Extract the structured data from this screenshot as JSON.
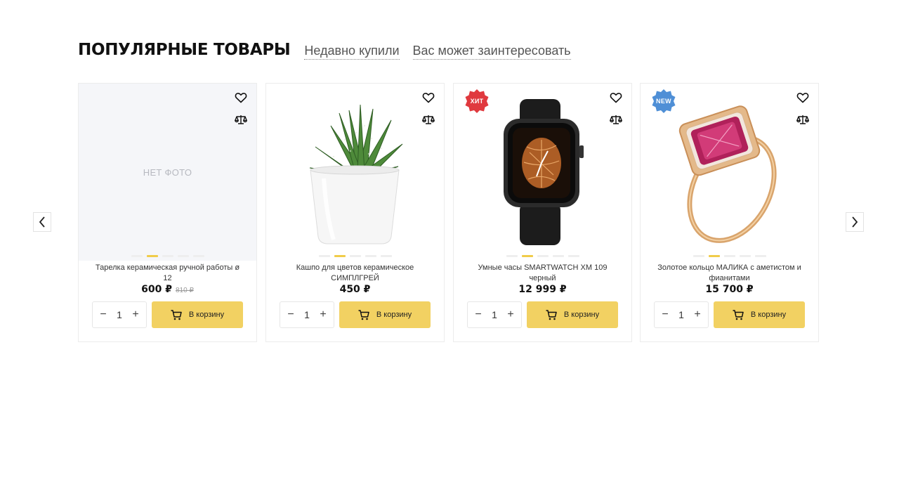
{
  "tabs": {
    "active": "ПОПУЛЯРНЫЕ ТОВАРЫ",
    "recent": "Недавно купили",
    "interest": "Вас может заинтересовать"
  },
  "no_photo": "НЕТ ФОТО",
  "products": [
    {
      "name": "Тарелка керамическая ручной работы ø 12",
      "price": "600 ₽",
      "old_price": "810 ₽",
      "qty": "1",
      "cart_label": "В корзину",
      "badge": null,
      "image": "no-photo",
      "active_slide": 2
    },
    {
      "name": "Кашпо для цветов керамическое СИМПЛГРЕЙ",
      "price": "450 ₽",
      "qty": "1",
      "cart_label": "В корзину",
      "badge": null,
      "image": "potted-plant",
      "active_slide": 2
    },
    {
      "name": "Умные часы SMARTWATCH XM 109 черный",
      "price": "12 999 ₽",
      "qty": "1",
      "cart_label": "В корзину",
      "badge": "ХИТ",
      "badge_color": "#e0393e",
      "image": "smartwatch",
      "active_slide": 2
    },
    {
      "name": "Золотое кольцо МАЛИКА с аметистом и фианитами",
      "price": "15 700 ₽",
      "qty": "1",
      "cart_label": "В корзину",
      "badge": "NEW",
      "badge_color": "#4f8fd6",
      "image": "gold-ring",
      "active_slide": 2
    }
  ],
  "colors": {
    "accent": "#f2d162",
    "active_dot": "#f0cc4a"
  }
}
